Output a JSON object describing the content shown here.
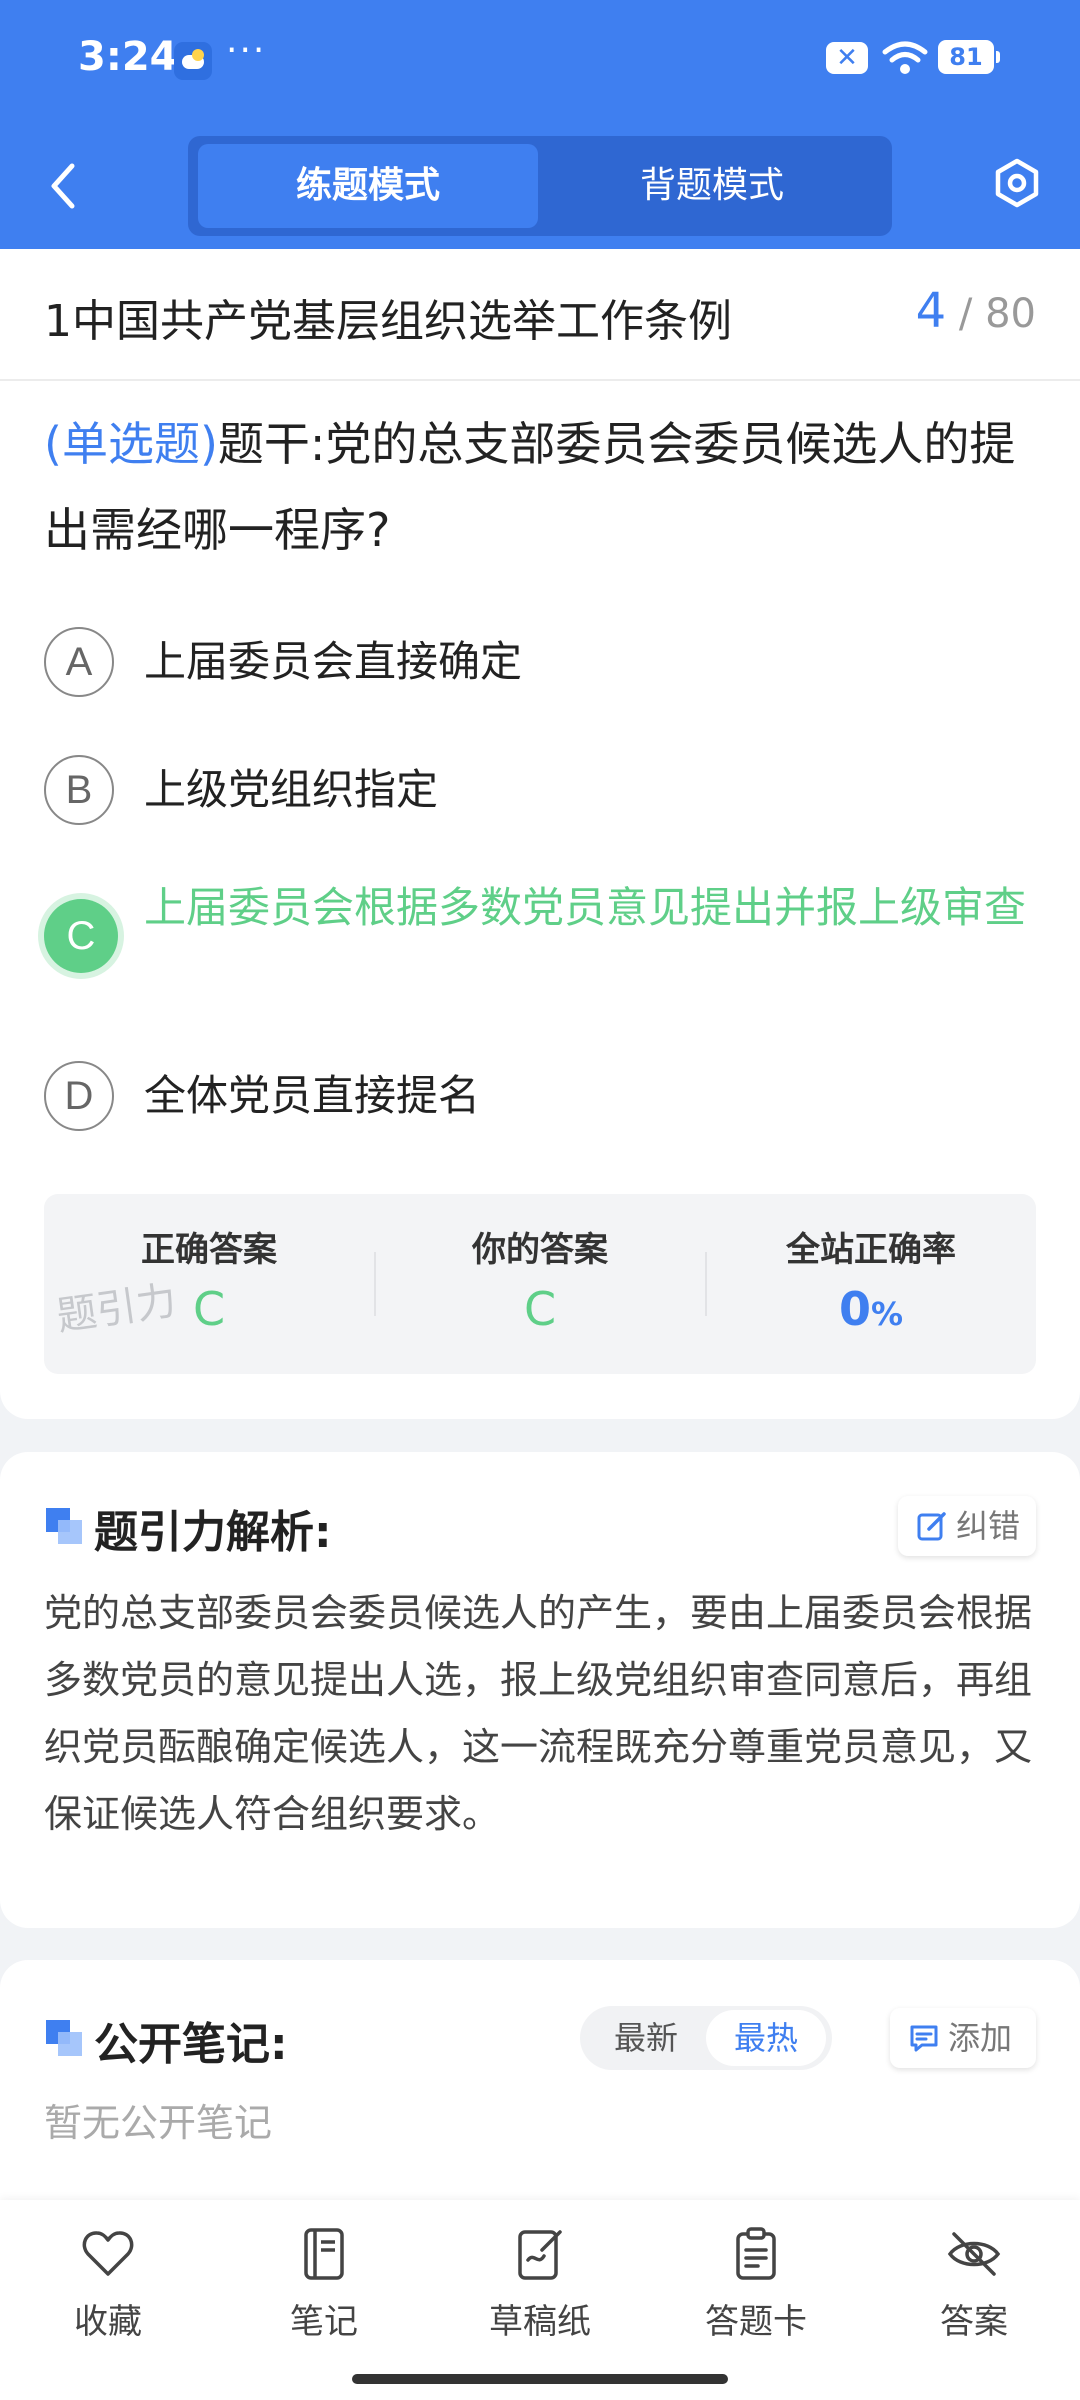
{
  "status_bar": {
    "time": "3:24",
    "battery": "81"
  },
  "header": {
    "tabs": [
      {
        "label": "练题模式",
        "active": true
      },
      {
        "label": "背题模式",
        "active": false
      }
    ]
  },
  "question": {
    "chapter_title": "1中国共产党基层组织选举工作条例",
    "current_index": "4",
    "total_label": "/ 80",
    "type_label": "(单选题)",
    "stem": "题干:党的总支部委员会委员候选人的提出需经哪一程序?",
    "options": [
      {
        "letter": "A",
        "text": "上届委员会直接确定"
      },
      {
        "letter": "B",
        "text": "上级党组织指定"
      },
      {
        "letter": "C",
        "text": "上届委员会根据多数党员意见提出并报上级审查"
      },
      {
        "letter": "D",
        "text": "全体党员直接提名"
      }
    ]
  },
  "stats": {
    "correct_label": "正确答案",
    "correct_value": "C",
    "yours_label": "你的答案",
    "yours_value": "C",
    "rate_label": "全站正确率",
    "rate_value": "0",
    "rate_unit": "%",
    "watermark": "题引力"
  },
  "analysis": {
    "title": "题引力解析:",
    "report_label": "纠错",
    "text": "党的总支部委员会委员候选人的产生，要由上届委员会根据多数党员的意见提出人选，报上级党组织审查同意后，再组织党员酝酿确定候选人，这一流程既充分尊重党员意见，又保证候选人符合组织要求。"
  },
  "notes": {
    "title": "公开笔记:",
    "sort_newest": "最新",
    "sort_hottest": "最热",
    "add_label": "添加",
    "empty_text": "暂无公开笔记"
  },
  "bottom_nav": {
    "favorite": "收藏",
    "note": "笔记",
    "scratch": "草稿纸",
    "answer_card": "答题卡",
    "answer": "答案"
  },
  "colors": {
    "primary": "#3f7ff0",
    "correct_green": "#5fcf88"
  }
}
